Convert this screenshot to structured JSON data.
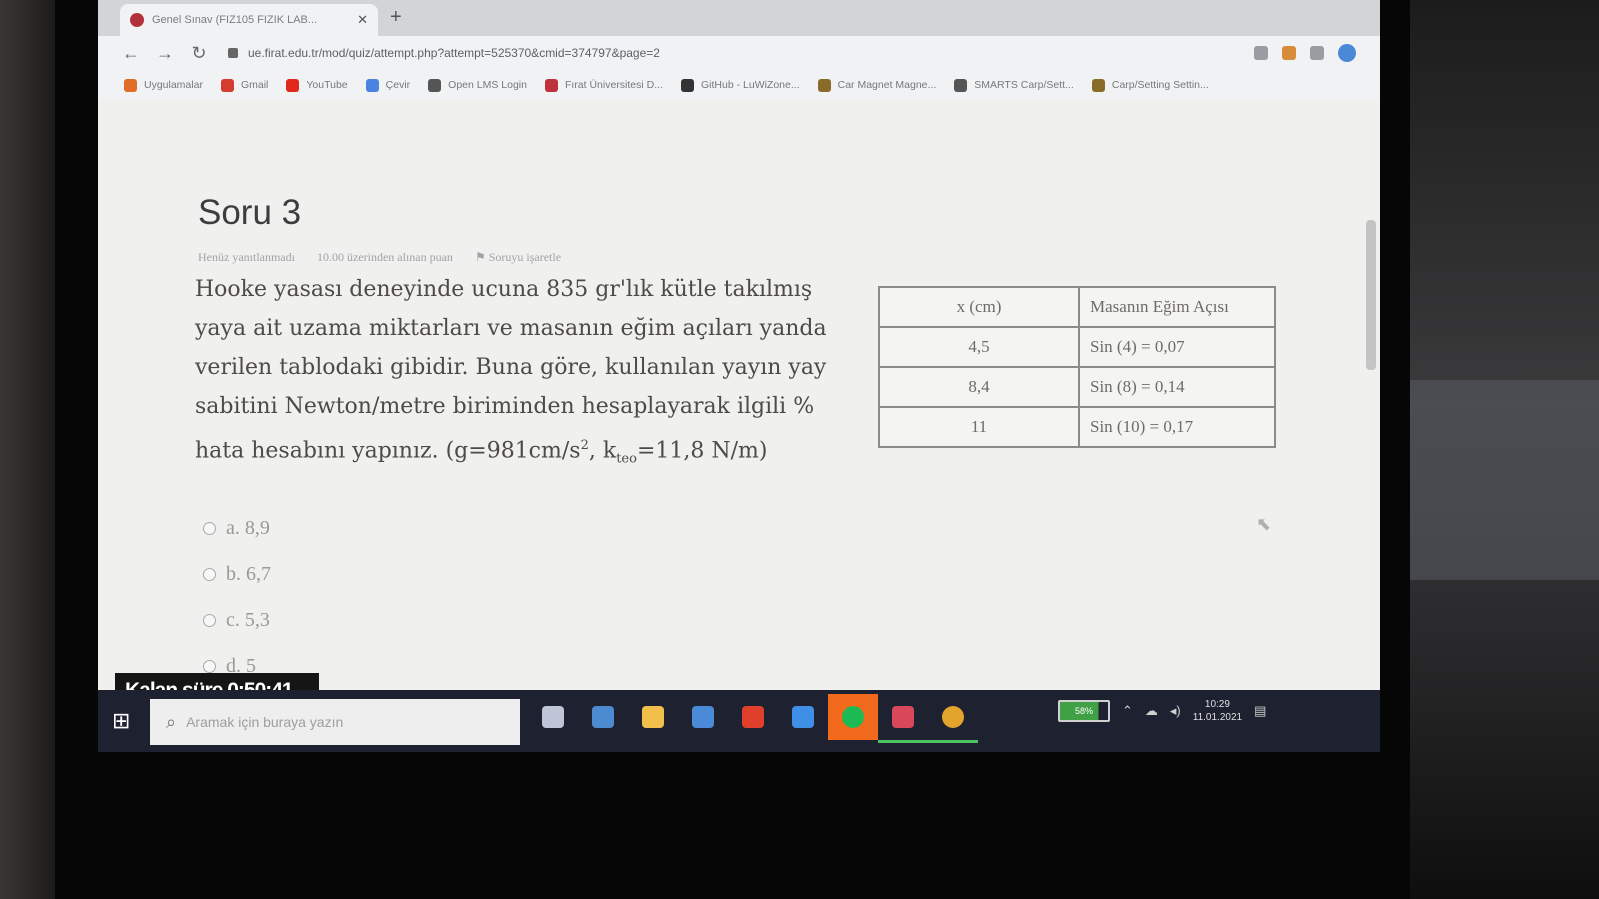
{
  "browser": {
    "tab_title": "Genel Sınav (FIZ105 FIZIK LAB...",
    "url": "ue.firat.edu.tr/mod/quiz/attempt.php?attempt=525370&cmid=374797&page=2",
    "bookmarks": [
      {
        "label": "Uygulamalar",
        "icon": "apps-grid-icon",
        "color": "#e06e28"
      },
      {
        "label": "Gmail",
        "icon": "gmail-icon",
        "color": "#d43c2f"
      },
      {
        "label": "YouTube",
        "icon": "youtube-icon",
        "color": "#e0271c"
      },
      {
        "label": "Çevir",
        "icon": "translate-icon",
        "color": "#4a83e0"
      },
      {
        "label": "Open LMS Login",
        "icon": "openlms-icon",
        "color": "#555555"
      },
      {
        "label": "Fırat Üniversitesi D...",
        "icon": "firat-icon",
        "color": "#c0323b"
      },
      {
        "label": "GitHub - LuWiZone...",
        "icon": "github-icon",
        "color": "#333333"
      },
      {
        "label": "Car Magnet Magne...",
        "icon": "bookmark-icon",
        "color": "#8a6c2a"
      },
      {
        "label": "SMARTS Carp/Sett...",
        "icon": "bookmark-icon",
        "color": "#555555"
      },
      {
        "label": "Carp/Setting Settin...",
        "icon": "bookmark-icon",
        "color": "#8a6c2a"
      }
    ]
  },
  "question": {
    "title": "Soru 3",
    "status": "Henüz yanıtlanmadı",
    "points": "10.00 üzerinden alınan puan",
    "flag": "Soruyu işaretle",
    "text_main": "Hooke yasası deneyinde ucuna 835 gr'lık kütle takılmış yaya ait uzama miktarları ve masanın eğim açıları yanda verilen tablodaki gibidir. Buna göre, kullanılan yayın yay sabitini Newton/metre biriminden hesaplayarak ilgili % hata hesabını yapınız. (g=981cm/s",
    "sup": "2",
    "text_k": ", k",
    "sub": "teo",
    "text_end": "=11,8 N/m)"
  },
  "table": {
    "headers": [
      "x (cm)",
      "Masanın Eğim Açısı"
    ],
    "rows": [
      [
        "4,5",
        "Sin (4) = 0,07"
      ],
      [
        "8,4",
        "Sin (8) = 0,14"
      ],
      [
        "11",
        "Sin (10) = 0,17"
      ]
    ]
  },
  "answers": [
    "a. 8,9",
    "b. 6,7",
    "c. 5,3",
    "d. 5"
  ],
  "timer": "Kalan süre 0:50:41",
  "taskbar": {
    "search_placeholder": "Aramak için buraya yazın",
    "battery": "58%",
    "time": "10:29",
    "date": "11.01.2021",
    "icons": [
      {
        "name": "task-view-icon",
        "color": "#bfc5d6"
      },
      {
        "name": "laptop-app-icon",
        "color": "#4c8bd0"
      },
      {
        "name": "file-explorer-icon",
        "color": "#f1c04a"
      },
      {
        "name": "mail-icon",
        "color": "#4a8ad6"
      },
      {
        "name": "office-icon",
        "color": "#e0402b"
      },
      {
        "name": "phone-app-icon",
        "color": "#3f8fe6"
      },
      {
        "name": "spotify-icon",
        "color": "#1db954"
      },
      {
        "name": "remote-desktop-icon",
        "color": "#d8485a"
      },
      {
        "name": "chrome-icon",
        "color": "#e2a42b"
      }
    ]
  }
}
